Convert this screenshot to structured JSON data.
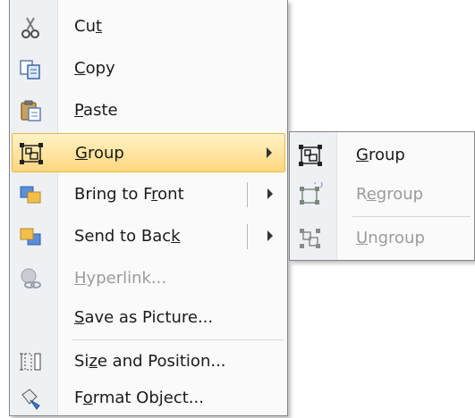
{
  "main_menu": {
    "items": [
      {
        "pre": "Cu",
        "u": "t",
        "post": "",
        "disabled": false
      },
      {
        "pre": "",
        "u": "C",
        "post": "opy",
        "disabled": false
      },
      {
        "pre": "",
        "u": "P",
        "post": "aste",
        "disabled": false
      },
      {
        "pre": "",
        "u": "G",
        "post": "roup",
        "disabled": false
      },
      {
        "pre": "Bring to F",
        "u": "r",
        "post": "ont",
        "disabled": false
      },
      {
        "pre": "Send to Bac",
        "u": "k",
        "post": "",
        "disabled": false
      },
      {
        "pre": "",
        "u": "H",
        "post": "yperlink...",
        "disabled": true
      },
      {
        "pre": "",
        "u": "S",
        "post": "ave as Picture...",
        "disabled": false
      },
      {
        "pre": "Si",
        "u": "z",
        "post": "e and Position...",
        "disabled": false
      },
      {
        "pre": "F",
        "u": "o",
        "post": "rmat Object...",
        "disabled": false
      }
    ]
  },
  "sub_menu": {
    "items": [
      {
        "pre": "",
        "u": "G",
        "post": "roup",
        "disabled": false
      },
      {
        "pre": "R",
        "u": "e",
        "post": "group",
        "disabled": true
      },
      {
        "pre": "",
        "u": "U",
        "post": "ngroup",
        "disabled": true
      }
    ]
  },
  "icons": {
    "cut": "scissors-icon",
    "copy": "copy-icon",
    "paste": "paste-icon",
    "group": "group-icon",
    "bring_to_front": "bring-to-front-icon",
    "send_to_back": "send-to-back-icon",
    "hyperlink": "hyperlink-icon",
    "size_position": "size-position-icon",
    "format_object": "format-object-icon",
    "regroup": "regroup-icon",
    "ungroup": "ungroup-icon"
  },
  "colors": {
    "highlight_top": "#fff3c4",
    "highlight_bottom": "#ffd77f",
    "highlight_border": "#e6b84f",
    "disabled_text": "#9b9b9b"
  }
}
